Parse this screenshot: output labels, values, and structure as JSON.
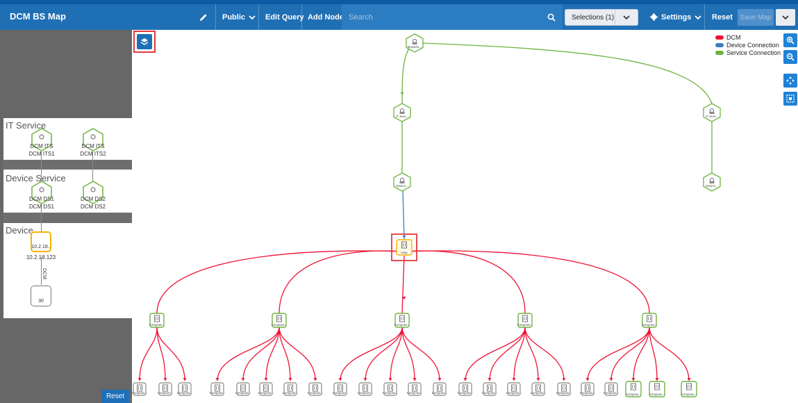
{
  "app": {
    "title": "DCM BS Map"
  },
  "toolbar": {
    "public_label": "Public",
    "edit_query_label": "Edit Query",
    "add_node_label": "Add Node",
    "search_placeholder": "Search",
    "selections_label": "Selections (1)",
    "settings_label": "Settings",
    "reset_label": "Reset",
    "save_map_label": "Save Map"
  },
  "legend": [
    {
      "label": "DCM",
      "color": "#ee1133"
    },
    {
      "label": "Device Connection",
      "color": "#3a7cc2"
    },
    {
      "label": "Service Connection",
      "color": "#6db33f"
    }
  ],
  "left_panel": {
    "lanes": [
      {
        "title": "IT Service",
        "nodes": [
          {
            "inner": "DCM ITS",
            "label": "DCM ITS1"
          },
          {
            "inner": "DCM ITS",
            "label": "DCM ITS2"
          }
        ]
      },
      {
        "title": "Device Service",
        "nodes": [
          {
            "inner": "DCM DS1",
            "label": "DCM DS1"
          },
          {
            "inner": "DCM DS2",
            "label": "DCM DS2"
          }
        ]
      },
      {
        "title": "Device",
        "nodes": [
          {
            "inner": "10.2.18..",
            "label": "10.2.18.123"
          },
          {
            "inner": "30",
            "label": ""
          }
        ]
      }
    ],
    "edge_label": "DCM",
    "reset_label": "Reset"
  },
  "map": {
    "root": {
      "label": "Busines..."
    },
    "it_services": [
      {
        "label": "IT Serv..."
      },
      {
        "label": "IT Serv..."
      }
    ],
    "device_services": [
      {
        "label": "Device..."
      },
      {
        "label": "Device..."
      }
    ],
    "device": {
      "label": "Icmp"
    },
    "components": [
      {
        "label": "Compone..."
      },
      {
        "label": "Compone..."
      },
      {
        "label": "Compone..."
      },
      {
        "label": "Compone..."
      },
      {
        "label": "Compone..."
      }
    ],
    "leaf_label": "Compone..."
  },
  "colors": {
    "brand": "#1f6fb5",
    "dcm": "#ee1133",
    "device_connection": "#3a7cc2",
    "service_connection": "#6db33f",
    "selected": "#f5b400",
    "highlight": "#e0393e"
  },
  "icons": [
    "pencil-icon",
    "chevron-down-icon",
    "search-icon",
    "gear-icon",
    "layers-icon",
    "zoom-in-icon",
    "zoom-out-icon",
    "move-icon",
    "fit-icon",
    "service-icon",
    "device-icon"
  ]
}
